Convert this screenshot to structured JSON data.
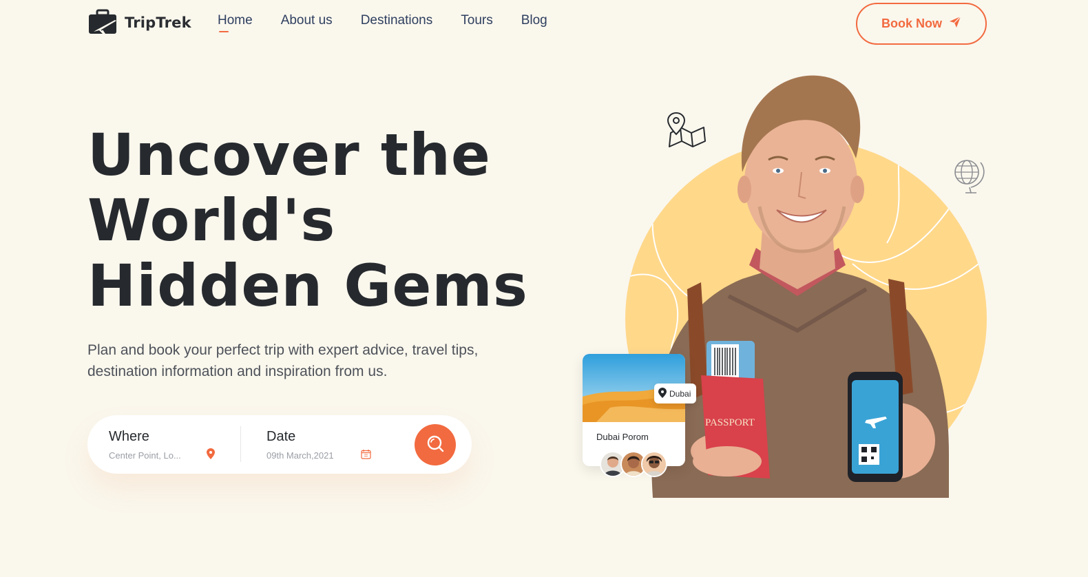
{
  "brand": {
    "name": "TripTrek",
    "accent": "#f26a3f",
    "dark": "#262a2e",
    "background": "#faf7ed",
    "circle": "#ffd88a"
  },
  "nav": {
    "items": [
      {
        "label": "Home",
        "active": true
      },
      {
        "label": "About us"
      },
      {
        "label": "Destinations"
      },
      {
        "label": "Tours"
      },
      {
        "label": "Blog"
      }
    ],
    "cta_label": "Book Now",
    "cta_icon": "paper-plane-icon"
  },
  "hero": {
    "title_lines": [
      "Uncover the",
      "World's",
      "Hidden Gems"
    ],
    "subtitle": "Plan and book your perfect trip with expert advice, travel tips, destination information and inspiration from us."
  },
  "search": {
    "where": {
      "label": "Where",
      "value": "Center Point, Lo...",
      "icon": "location-pin-icon"
    },
    "date": {
      "label": "Date",
      "value": "09th March,2021",
      "icon": "calendar-icon"
    },
    "button_icon": "search-icon"
  },
  "illustration": {
    "destination_card": {
      "name": "Dubai Porom",
      "tag": "Dubai",
      "tag_icon": "location-pin-icon"
    },
    "passport_text": "PASSPORT",
    "icons": [
      "map-icon",
      "globe-icon"
    ]
  }
}
